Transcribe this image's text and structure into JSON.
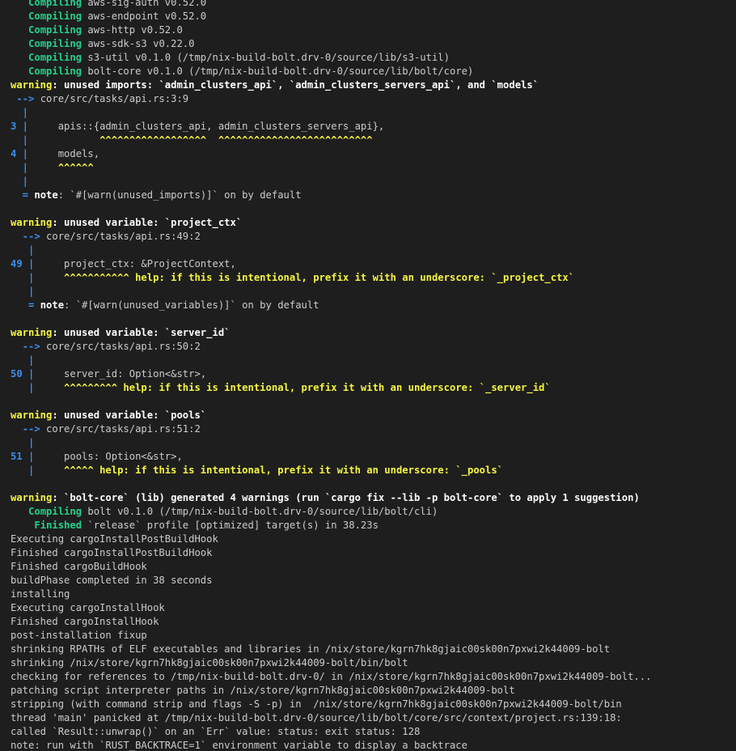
{
  "terminal": {
    "lines": [
      [
        {
          "t": "   ",
          "c": "d"
        },
        {
          "t": "Compiling",
          "c": "g"
        },
        {
          "t": " aws-sig-auth v0.52.0",
          "c": "d"
        }
      ],
      [
        {
          "t": "   ",
          "c": "d"
        },
        {
          "t": "Compiling",
          "c": "g"
        },
        {
          "t": " aws-endpoint v0.52.0",
          "c": "d"
        }
      ],
      [
        {
          "t": "   ",
          "c": "d"
        },
        {
          "t": "Compiling",
          "c": "g"
        },
        {
          "t": " aws-http v0.52.0",
          "c": "d"
        }
      ],
      [
        {
          "t": "   ",
          "c": "d"
        },
        {
          "t": "Compiling",
          "c": "g"
        },
        {
          "t": " aws-sdk-s3 v0.22.0",
          "c": "d"
        }
      ],
      [
        {
          "t": "   ",
          "c": "d"
        },
        {
          "t": "Compiling",
          "c": "g"
        },
        {
          "t": " s3-util v0.1.0 (/tmp/nix-build-bolt.drv-0/source/lib/s3-util)",
          "c": "d"
        }
      ],
      [
        {
          "t": "   ",
          "c": "d"
        },
        {
          "t": "Compiling",
          "c": "g"
        },
        {
          "t": " bolt-core v0.1.0 (/tmp/nix-build-bolt.drv-0/source/lib/bolt/core)",
          "c": "d"
        }
      ],
      [
        {
          "t": "warning",
          "c": "y"
        },
        {
          "t": ": unused imports: `admin_clusters_api`, `admin_clusters_servers_api`, and `models`",
          "c": "w"
        }
      ],
      [
        {
          "t": " --> ",
          "c": "b"
        },
        {
          "t": "core/src/tasks/api.rs:3:9",
          "c": "d"
        }
      ],
      [
        {
          "t": "  |",
          "c": "b"
        }
      ],
      [
        {
          "t": "3 |",
          "c": "b"
        },
        {
          "t": "     apis::{admin_clusters_api, admin_clusters_servers_api},",
          "c": "d"
        }
      ],
      [
        {
          "t": "  |",
          "c": "b"
        },
        {
          "t": "            ^^^^^^^^^^^^^^^^^^  ^^^^^^^^^^^^^^^^^^^^^^^^^^",
          "c": "y"
        }
      ],
      [
        {
          "t": "4 |",
          "c": "b"
        },
        {
          "t": "     models,",
          "c": "d"
        }
      ],
      [
        {
          "t": "  |",
          "c": "b"
        },
        {
          "t": "     ^^^^^^",
          "c": "y"
        }
      ],
      [
        {
          "t": "  |",
          "c": "b"
        }
      ],
      [
        {
          "t": "  = ",
          "c": "b"
        },
        {
          "t": "note",
          "c": "w"
        },
        {
          "t": ": `#[warn(unused_imports)]` on by default",
          "c": "d"
        }
      ],
      [
        {
          "t": "",
          "c": "d"
        }
      ],
      [
        {
          "t": "warning",
          "c": "y"
        },
        {
          "t": ": unused variable: `project_ctx`",
          "c": "w"
        }
      ],
      [
        {
          "t": "  --> ",
          "c": "b"
        },
        {
          "t": "core/src/tasks/api.rs:49:2",
          "c": "d"
        }
      ],
      [
        {
          "t": "   |",
          "c": "b"
        }
      ],
      [
        {
          "t": "49 |",
          "c": "b"
        },
        {
          "t": "     project_ctx: &ProjectContext,",
          "c": "d"
        }
      ],
      [
        {
          "t": "   |",
          "c": "b"
        },
        {
          "t": "     ^^^^^^^^^^^ help: if this is intentional, prefix it with an underscore: `_project_ctx`",
          "c": "y"
        }
      ],
      [
        {
          "t": "   |",
          "c": "b"
        }
      ],
      [
        {
          "t": "   = ",
          "c": "b"
        },
        {
          "t": "note",
          "c": "w"
        },
        {
          "t": ": `#[warn(unused_variables)]` on by default",
          "c": "d"
        }
      ],
      [
        {
          "t": "",
          "c": "d"
        }
      ],
      [
        {
          "t": "warning",
          "c": "y"
        },
        {
          "t": ": unused variable: `server_id`",
          "c": "w"
        }
      ],
      [
        {
          "t": "  --> ",
          "c": "b"
        },
        {
          "t": "core/src/tasks/api.rs:50:2",
          "c": "d"
        }
      ],
      [
        {
          "t": "   |",
          "c": "b"
        }
      ],
      [
        {
          "t": "50 |",
          "c": "b"
        },
        {
          "t": "     server_id: Option<&str>,",
          "c": "d"
        }
      ],
      [
        {
          "t": "   |",
          "c": "b"
        },
        {
          "t": "     ^^^^^^^^^ help: if this is intentional, prefix it with an underscore: `_server_id`",
          "c": "y"
        }
      ],
      [
        {
          "t": "",
          "c": "d"
        }
      ],
      [
        {
          "t": "warning",
          "c": "y"
        },
        {
          "t": ": unused variable: `pools`",
          "c": "w"
        }
      ],
      [
        {
          "t": "  --> ",
          "c": "b"
        },
        {
          "t": "core/src/tasks/api.rs:51:2",
          "c": "d"
        }
      ],
      [
        {
          "t": "   |",
          "c": "b"
        }
      ],
      [
        {
          "t": "51 |",
          "c": "b"
        },
        {
          "t": "     pools: Option<&str>,",
          "c": "d"
        }
      ],
      [
        {
          "t": "   |",
          "c": "b"
        },
        {
          "t": "     ^^^^^ help: if this is intentional, prefix it with an underscore: `_pools`",
          "c": "y"
        }
      ],
      [
        {
          "t": "",
          "c": "d"
        }
      ],
      [
        {
          "t": "warning",
          "c": "y"
        },
        {
          "t": ": `bolt-core` (lib) generated 4 warnings (run `cargo fix --lib -p bolt-core` to apply 1 suggestion)",
          "c": "w"
        }
      ],
      [
        {
          "t": "   ",
          "c": "d"
        },
        {
          "t": "Compiling",
          "c": "g"
        },
        {
          "t": " bolt v0.1.0 (/tmp/nix-build-bolt.drv-0/source/lib/bolt/cli)",
          "c": "d"
        }
      ],
      [
        {
          "t": "    ",
          "c": "d"
        },
        {
          "t": "Finished",
          "c": "g"
        },
        {
          "t": " `release` profile [optimized] target(s) in 38.23s",
          "c": "d"
        }
      ],
      [
        {
          "t": "Executing cargoInstallPostBuildHook",
          "c": "d"
        }
      ],
      [
        {
          "t": "Finished cargoInstallPostBuildHook",
          "c": "d"
        }
      ],
      [
        {
          "t": "Finished cargoBuildHook",
          "c": "d"
        }
      ],
      [
        {
          "t": "buildPhase completed in 38 seconds",
          "c": "d"
        }
      ],
      [
        {
          "t": "installing",
          "c": "d"
        }
      ],
      [
        {
          "t": "Executing cargoInstallHook",
          "c": "d"
        }
      ],
      [
        {
          "t": "Finished cargoInstallHook",
          "c": "d"
        }
      ],
      [
        {
          "t": "post-installation fixup",
          "c": "d"
        }
      ],
      [
        {
          "t": "shrinking RPATHs of ELF executables and libraries in /nix/store/kgrn7hk8gjaic00sk00n7pxwi2k44009-bolt",
          "c": "d"
        }
      ],
      [
        {
          "t": "shrinking /nix/store/kgrn7hk8gjaic00sk00n7pxwi2k44009-bolt/bin/bolt",
          "c": "d"
        }
      ],
      [
        {
          "t": "checking for references to /tmp/nix-build-bolt.drv-0/ in /nix/store/kgrn7hk8gjaic00sk00n7pxwi2k44009-bolt...",
          "c": "d"
        }
      ],
      [
        {
          "t": "patching script interpreter paths in /nix/store/kgrn7hk8gjaic00sk00n7pxwi2k44009-bolt",
          "c": "d"
        }
      ],
      [
        {
          "t": "stripping (with command strip and flags -S -p) in  /nix/store/kgrn7hk8gjaic00sk00n7pxwi2k44009-bolt/bin",
          "c": "d"
        }
      ],
      [
        {
          "t": "thread 'main' panicked at /tmp/nix-build-bolt.drv-0/source/lib/bolt/core/src/context/project.rs:139:18:",
          "c": "d"
        }
      ],
      [
        {
          "t": "called `Result::unwrap()` on an `Err` value: status: exit status: 128",
          "c": "d"
        }
      ],
      [
        {
          "t": "note: run with `RUST_BACKTRACE=1` environment variable to display a backtrace",
          "c": "d"
        }
      ]
    ]
  }
}
